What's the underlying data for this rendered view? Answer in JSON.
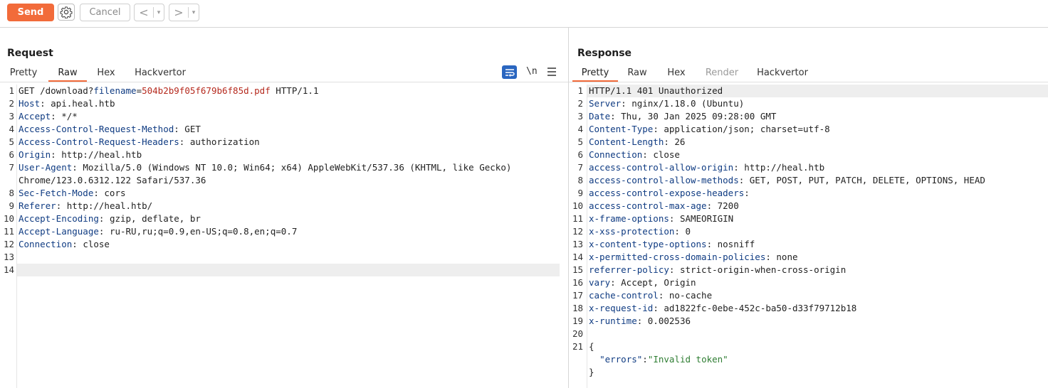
{
  "toolbar": {
    "send_label": "Send",
    "cancel_label": "Cancel",
    "back_arrow": "<",
    "forward_arrow": ">",
    "dropdown_glyph": "▾"
  },
  "request": {
    "title": "Request",
    "tabs": [
      "Pretty",
      "Raw",
      "Hex",
      "Hackvertor"
    ],
    "active_tab": "Raw",
    "newline_toggle": "\\n",
    "line_numbers": [
      "1",
      "2",
      "3",
      "4",
      "5",
      "6",
      "7",
      "",
      "8",
      "9",
      "10",
      "11",
      "12",
      "13",
      "14"
    ],
    "request_line": {
      "method_path": "GET /download?",
      "param_name": "filename",
      "equals": "=",
      "param_value": "504b2b9f05f679b6f85d.pdf",
      "protocol": " HTTP/1.1"
    },
    "headers": [
      {
        "name": "Host",
        "value": ": api.heal.htb"
      },
      {
        "name": "Accept",
        "value": ": */*"
      },
      {
        "name": "Access-Control-Request-Method",
        "value": ": GET"
      },
      {
        "name": "Access-Control-Request-Headers",
        "value": ": authorization"
      },
      {
        "name": "Origin",
        "value": ": http://heal.htb"
      },
      {
        "name": "User-Agent",
        "value": ": Mozilla/5.0 (Windows NT 10.0; Win64; x64) AppleWebKit/537.36 (KHTML, like Gecko)"
      },
      {
        "name": "",
        "value": "Chrome/123.0.6312.122 Safari/537.36"
      },
      {
        "name": "Sec-Fetch-Mode",
        "value": ": cors"
      },
      {
        "name": "Referer",
        "value": ": http://heal.htb/"
      },
      {
        "name": "Accept-Encoding",
        "value": ": gzip, deflate, br"
      },
      {
        "name": "Accept-Language",
        "value": ": ru-RU,ru;q=0.9,en-US;q=0.8,en;q=0.7"
      },
      {
        "name": "Connection",
        "value": ": close"
      }
    ]
  },
  "response": {
    "title": "Response",
    "tabs": [
      "Pretty",
      "Raw",
      "Hex",
      "Render",
      "Hackvertor"
    ],
    "active_tab": "Pretty",
    "disabled_tab": "Render",
    "line_numbers": [
      "1",
      "2",
      "3",
      "4",
      "5",
      "6",
      "7",
      "8",
      "9",
      "10",
      "11",
      "12",
      "13",
      "14",
      "15",
      "16",
      "17",
      "18",
      "19",
      "20",
      "21",
      "",
      ""
    ],
    "status_line": "HTTP/1.1 401 Unauthorized",
    "headers": [
      {
        "name": "Server",
        "value": ": nginx/1.18.0 (Ubuntu)"
      },
      {
        "name": "Date",
        "value": ": Thu, 30 Jan 2025 09:28:00 GMT"
      },
      {
        "name": "Content-Type",
        "value": ": application/json; charset=utf-8"
      },
      {
        "name": "Content-Length",
        "value": ": 26"
      },
      {
        "name": "Connection",
        "value": ": close"
      },
      {
        "name": "access-control-allow-origin",
        "value": ": http://heal.htb"
      },
      {
        "name": "access-control-allow-methods",
        "value": ": GET, POST, PUT, PATCH, DELETE, OPTIONS, HEAD"
      },
      {
        "name": "access-control-expose-headers",
        "value": ":"
      },
      {
        "name": "access-control-max-age",
        "value": ": 7200"
      },
      {
        "name": "x-frame-options",
        "value": ": SAMEORIGIN"
      },
      {
        "name": "x-xss-protection",
        "value": ": 0"
      },
      {
        "name": "x-content-type-options",
        "value": ": nosniff"
      },
      {
        "name": "x-permitted-cross-domain-policies",
        "value": ": none"
      },
      {
        "name": "referrer-policy",
        "value": ": strict-origin-when-cross-origin"
      },
      {
        "name": "vary",
        "value": ": Accept, Origin"
      },
      {
        "name": "cache-control",
        "value": ": no-cache"
      },
      {
        "name": "x-request-id",
        "value": ": ad1822fc-0ebe-452c-ba50-d33f79712b18"
      },
      {
        "name": "x-runtime",
        "value": ": 0.002536"
      }
    ],
    "body": {
      "open_brace": "{",
      "indent": "  ",
      "key": "\"errors\"",
      "colon": ":",
      "value": "\"Invalid token\"",
      "close_brace": "}"
    }
  }
}
